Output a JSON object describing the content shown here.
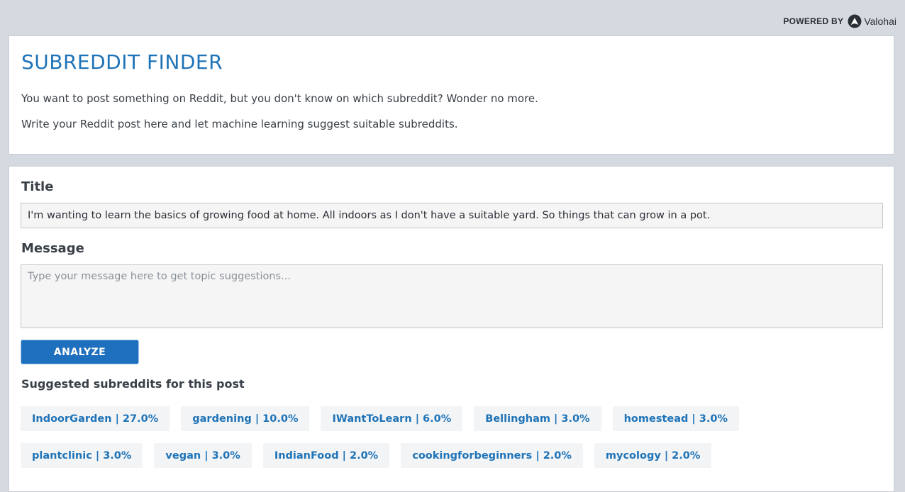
{
  "powered_by": {
    "label": "POWERED BY",
    "brand": "Valohai",
    "icon": "valohai-logo-icon"
  },
  "intro": {
    "title": "SUBREDDIT FINDER",
    "line1": "You want to post something on Reddit, but you don't know on which subreddit? Wonder no more.",
    "line2": "Write your Reddit post here and let machine learning suggest suitable subreddits."
  },
  "form": {
    "title_label": "Title",
    "title_value": "I'm wanting to learn the basics of growing food at home. All indoors as I don't have a suitable yard. So things that can grow in a pot.",
    "message_label": "Message",
    "message_placeholder": "Type your message here to get topic suggestions...",
    "analyze_label": "ANALYZE"
  },
  "suggestions": {
    "heading": "Suggested subreddits for this post",
    "items": [
      {
        "label": "IndoorGarden | 27.0%",
        "subreddit": "IndoorGarden",
        "percent": 27.0
      },
      {
        "label": "gardening | 10.0%",
        "subreddit": "gardening",
        "percent": 10.0
      },
      {
        "label": "IWantToLearn | 6.0%",
        "subreddit": "IWantToLearn",
        "percent": 6.0
      },
      {
        "label": "Bellingham | 3.0%",
        "subreddit": "Bellingham",
        "percent": 3.0
      },
      {
        "label": "homestead | 3.0%",
        "subreddit": "homestead",
        "percent": 3.0
      },
      {
        "label": "plantclinic | 3.0%",
        "subreddit": "plantclinic",
        "percent": 3.0
      },
      {
        "label": "vegan | 3.0%",
        "subreddit": "vegan",
        "percent": 3.0
      },
      {
        "label": "IndianFood | 2.0%",
        "subreddit": "IndianFood",
        "percent": 2.0
      },
      {
        "label": "cookingforbeginners | 2.0%",
        "subreddit": "cookingforbeginners",
        "percent": 2.0
      },
      {
        "label": "mycology | 2.0%",
        "subreddit": "mycology",
        "percent": 2.0
      }
    ]
  },
  "colors": {
    "accent": "#1f73b7",
    "button": "#1f6fbf",
    "background": "#d5dae1",
    "chip": "#f2f4f6"
  }
}
